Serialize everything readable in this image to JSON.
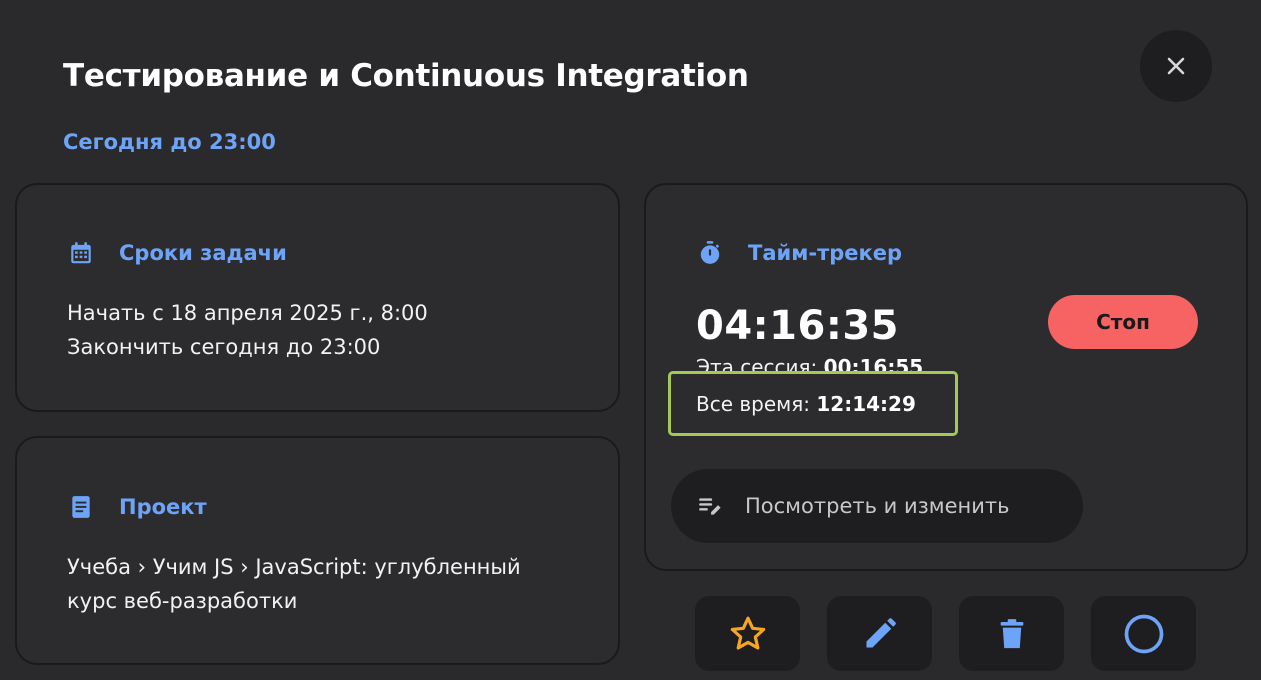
{
  "header": {
    "title": "Тестирование и Continuous Integration",
    "deadline": "Сегодня до 23:00",
    "close_icon": "close-icon"
  },
  "deadlines_card": {
    "icon": "calendar-icon",
    "heading": "Сроки задачи",
    "start": "Начать с 18 апреля 2025 г., 8:00",
    "end": "Закончить сегодня до 23:00"
  },
  "project_card": {
    "icon": "document-icon",
    "heading": "Проект",
    "path_line1": "Учеба › Учим JS › JavaScript: углубленный",
    "path_line2": "курс веб-разработки"
  },
  "timer_card": {
    "icon": "stopwatch-icon",
    "heading": "Тайм-трекер",
    "elapsed": "04:16:35",
    "stop_label": "Стоп",
    "session_label": "Эта сессия:",
    "session_value": "00:16:55",
    "total_label": "Все время:",
    "total_value": "12:14:29",
    "view_label": "Посмотреть и изменить",
    "view_icon": "edit-notes-icon"
  },
  "actions": [
    {
      "icon": "star-icon"
    },
    {
      "icon": "pencil-icon"
    },
    {
      "icon": "trash-icon"
    },
    {
      "icon": "circle-icon"
    }
  ],
  "colors": {
    "accent": "#6ea4f7",
    "stop": "#f76363",
    "star": "#f5a623",
    "highlight": "#a4c955",
    "background": "#2a2a2d"
  }
}
